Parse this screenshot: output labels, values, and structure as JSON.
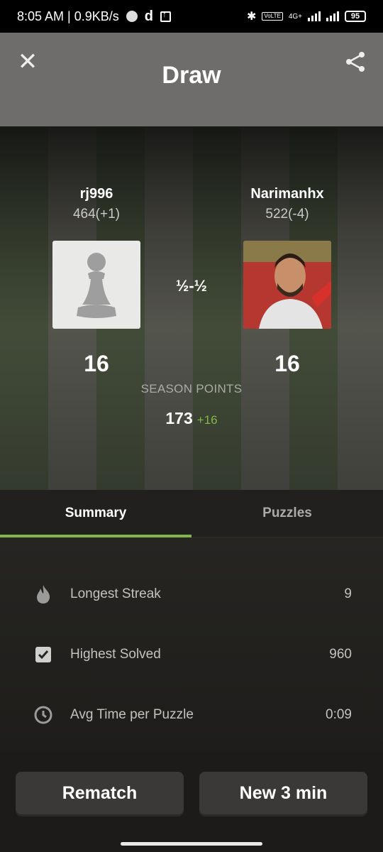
{
  "status_bar": {
    "time_speed": "8:05 AM | 0.9KB/s",
    "d_glyph": "d",
    "volte": "VoLTE",
    "network": "4G+",
    "battery": "95"
  },
  "header": {
    "title": "Draw"
  },
  "players": {
    "left": {
      "name": "rj996",
      "rating": "464(+1)",
      "season_points": "16"
    },
    "right": {
      "name": "Narimanhx",
      "rating": "522(-4)",
      "season_points": "16"
    }
  },
  "result": {
    "score": "½-½"
  },
  "season": {
    "label": "SEASON POINTS",
    "total": "173",
    "delta": "+16"
  },
  "tabs": [
    {
      "label": "Summary",
      "active": true
    },
    {
      "label": "Puzzles",
      "active": false
    }
  ],
  "stats": [
    {
      "icon": "flame-icon",
      "label": "Longest Streak",
      "value": "9"
    },
    {
      "icon": "checkbox-icon",
      "label": "Highest Solved",
      "value": "960"
    },
    {
      "icon": "clock-icon",
      "label": "Avg Time per Puzzle",
      "value": "0:09"
    }
  ],
  "buttons": {
    "rematch": "Rematch",
    "new_game": "New 3 min"
  },
  "colors": {
    "accent_green": "#81b64c",
    "header_bg": "#6f6d6b",
    "button_bg": "#3a3937"
  }
}
